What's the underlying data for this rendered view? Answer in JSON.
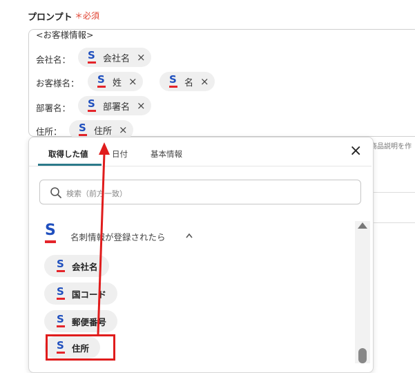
{
  "field": {
    "label": "プロンプト",
    "required_mark": "＊",
    "required_text": "必須"
  },
  "prompt": {
    "header": "<お客様情報>",
    "rows": [
      {
        "label": "会社名：",
        "tags": [
          "会社名"
        ]
      },
      {
        "label": "お客様名：",
        "tags": [
          "姓",
          "名"
        ]
      },
      {
        "label": "部署名：",
        "tags": [
          "部署名"
        ]
      },
      {
        "label": "住所：",
        "tags": [
          "住所"
        ]
      }
    ]
  },
  "cut_right_text": "商品説明を作",
  "panel": {
    "tabs": [
      "取得した値",
      "日付",
      "基本情報"
    ],
    "active_tab": 0,
    "close_label": "×",
    "search_placeholder": "検索（前方一致）",
    "group": {
      "title": "名刺情報が登録されたら",
      "caret": "^"
    },
    "items": [
      "会社名",
      "国コード",
      "郵便番号",
      "住所"
    ],
    "highlighted_item": "住所"
  },
  "icons": {
    "service_logo": "S",
    "tag_remove": "×"
  },
  "colors": {
    "required": "#e0402f",
    "logo_blue": "#1f4fbe",
    "logo_red": "#e4242a",
    "tab_accent": "#2b7a8a",
    "annotation": "#e01c1c"
  }
}
